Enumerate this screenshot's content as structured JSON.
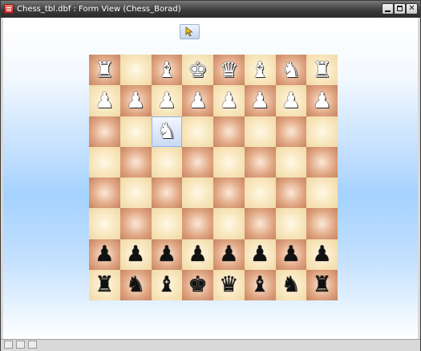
{
  "window": {
    "title": "Chess_tbl.dbf : Form View (Chess_Borad)",
    "min_label": "",
    "max_label": "",
    "close_label": "✕"
  },
  "toolbar": {
    "pointer_icon": "pointer-icon"
  },
  "board": {
    "selected_square": "c6",
    "ranks": [
      [
        {
          "p": "♜",
          "c": "white"
        },
        {
          "p": "",
          "c": ""
        },
        {
          "p": "♝",
          "c": "white"
        },
        {
          "p": "♚",
          "c": "white"
        },
        {
          "p": "♛",
          "c": "white"
        },
        {
          "p": "♝",
          "c": "white"
        },
        {
          "p": "♞",
          "c": "white"
        },
        {
          "p": "♜",
          "c": "white"
        }
      ],
      [
        {
          "p": "♟",
          "c": "white"
        },
        {
          "p": "♟",
          "c": "white"
        },
        {
          "p": "♟",
          "c": "white"
        },
        {
          "p": "♟",
          "c": "white"
        },
        {
          "p": "♟",
          "c": "white"
        },
        {
          "p": "♟",
          "c": "white"
        },
        {
          "p": "♟",
          "c": "white"
        },
        {
          "p": "♟",
          "c": "white"
        }
      ],
      [
        {
          "p": "",
          "c": ""
        },
        {
          "p": "",
          "c": ""
        },
        {
          "p": "♞",
          "c": "white"
        },
        {
          "p": "",
          "c": ""
        },
        {
          "p": "",
          "c": ""
        },
        {
          "p": "",
          "c": ""
        },
        {
          "p": "",
          "c": ""
        },
        {
          "p": "",
          "c": ""
        }
      ],
      [
        {
          "p": "",
          "c": ""
        },
        {
          "p": "",
          "c": ""
        },
        {
          "p": "",
          "c": ""
        },
        {
          "p": "",
          "c": ""
        },
        {
          "p": "",
          "c": ""
        },
        {
          "p": "",
          "c": ""
        },
        {
          "p": "",
          "c": ""
        },
        {
          "p": "",
          "c": ""
        }
      ],
      [
        {
          "p": "",
          "c": ""
        },
        {
          "p": "",
          "c": ""
        },
        {
          "p": "",
          "c": ""
        },
        {
          "p": "",
          "c": ""
        },
        {
          "p": "",
          "c": ""
        },
        {
          "p": "",
          "c": ""
        },
        {
          "p": "",
          "c": ""
        },
        {
          "p": "",
          "c": ""
        }
      ],
      [
        {
          "p": "",
          "c": ""
        },
        {
          "p": "",
          "c": ""
        },
        {
          "p": "",
          "c": ""
        },
        {
          "p": "",
          "c": ""
        },
        {
          "p": "",
          "c": ""
        },
        {
          "p": "",
          "c": ""
        },
        {
          "p": "",
          "c": ""
        },
        {
          "p": "",
          "c": ""
        }
      ],
      [
        {
          "p": "♟",
          "c": "black"
        },
        {
          "p": "♟",
          "c": "black"
        },
        {
          "p": "♟",
          "c": "black"
        },
        {
          "p": "♟",
          "c": "black"
        },
        {
          "p": "♟",
          "c": "black"
        },
        {
          "p": "♟",
          "c": "black"
        },
        {
          "p": "♟",
          "c": "black"
        },
        {
          "p": "♟",
          "c": "black"
        }
      ],
      [
        {
          "p": "♜",
          "c": "black"
        },
        {
          "p": "♞",
          "c": "black"
        },
        {
          "p": "♝",
          "c": "black"
        },
        {
          "p": "♚",
          "c": "black"
        },
        {
          "p": "♛",
          "c": "black"
        },
        {
          "p": "♝",
          "c": "black"
        },
        {
          "p": "♞",
          "c": "black"
        },
        {
          "p": "♜",
          "c": "black"
        }
      ]
    ]
  }
}
